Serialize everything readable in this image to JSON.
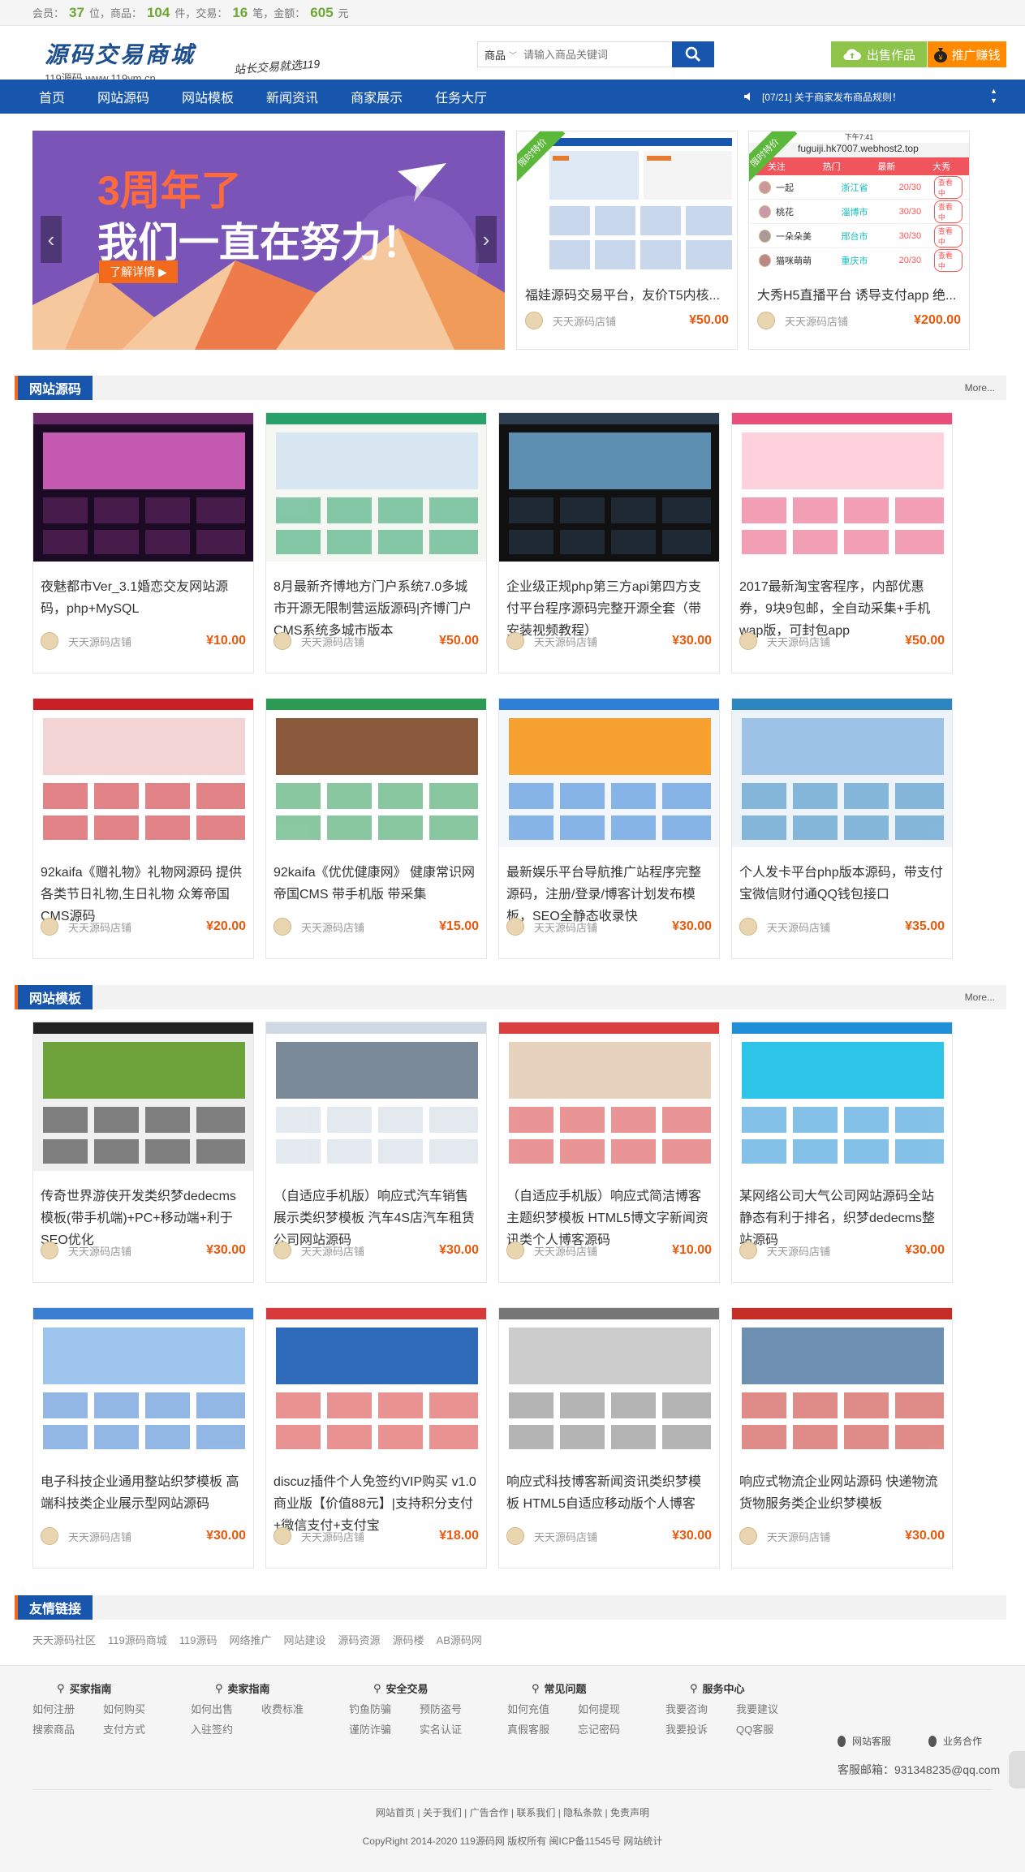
{
  "topbar": {
    "members_label": "会员：",
    "members": "37",
    "members_unit": "位，商品：",
    "goods": "104",
    "goods_unit": "件，交易：",
    "trades": "16",
    "trades_unit": "笔，金额：",
    "amount": "605",
    "amount_unit": "元"
  },
  "logo": {
    "title": "源码交易商城",
    "sub": "119源码   www.119ym.cn",
    "slogan": "站长交易就选119"
  },
  "search": {
    "category": "商品",
    "placeholder": "请输入商品关键词"
  },
  "header_buttons": {
    "sell": "出售作品",
    "promo": "推广赚钱"
  },
  "nav": {
    "items": [
      "首页",
      "网站源码",
      "网站模板",
      "新闻资讯",
      "商家展示",
      "任务大厅"
    ],
    "notice": "[07/21] 关于商家发布商品规则！"
  },
  "banner": {
    "line1": "3周年了",
    "line2": "我们一直在努力！",
    "button": "了解详情 ▶"
  },
  "featured": [
    {
      "ribbon": "限时特价",
      "title": "福娃源码交易平台，友价T5内核...",
      "shop": "天天源码店铺",
      "price": "¥50.00"
    },
    {
      "ribbon": "限时特价",
      "title": "大秀H5直播平台 诱导支付app 绝...",
      "shop": "天天源码店铺",
      "price": "¥200.00",
      "url": "fuguiji.hk7007.webhost2.top",
      "tabs": [
        "关注",
        "热门",
        "最新",
        "大秀"
      ],
      "status": "下午7:41",
      "rows": [
        {
          "name": "一起",
          "loc": "浙江省",
          "age": "20/30",
          "act": "查看中"
        },
        {
          "name": "桃花",
          "loc": "淄博市",
          "age": "30/30",
          "act": "查看中"
        },
        {
          "name": "一朵朵美",
          "loc": "邢台市",
          "age": "30/30",
          "act": "查看中"
        },
        {
          "name": "猫咪萌萌",
          "loc": "重庆市",
          "age": "20/30",
          "act": "查看中"
        }
      ]
    }
  ],
  "sections": [
    {
      "title": "网站源码",
      "more": "More...",
      "items": [
        {
          "title": "夜魅都市Ver_3.1婚恋交友网站源码，php+MySQL",
          "shop": "天天源码店铺",
          "price": "¥10.00"
        },
        {
          "title": "8月最新齐博地方门户系统7.0多城市开源无限制营运版源码|齐博门户CMS系统多城市版本",
          "shop": "天天源码店铺",
          "price": "¥50.00"
        },
        {
          "title": "企业级正规php第三方api第四方支付平台程序源码完整开源全套（带安装视频教程）",
          "shop": "天天源码店铺",
          "price": "¥30.00"
        },
        {
          "title": "2017最新淘宝客程序，内部优惠券，9块9包邮，全自动采集+手机wap版，可封包app",
          "shop": "天天源码店铺",
          "price": "¥50.00"
        },
        {
          "title": "92kaifa《赠礼物》礼物网源码 提供各类节日礼物,生日礼物 众筹帝国CMS源码",
          "shop": "天天源码店铺",
          "price": "¥20.00"
        },
        {
          "title": "92kaifa《优优健康网》 健康常识网帝国CMS 带手机版 带采集",
          "shop": "天天源码店铺",
          "price": "¥15.00"
        },
        {
          "title": "最新娱乐平台导航推广站程序完整源码，注册/登录/博客计划发布模板，SEO全静态收录快",
          "shop": "天天源码店铺",
          "price": "¥30.00"
        },
        {
          "title": "个人发卡平台php版本源码，带支付宝微信财付通QQ钱包接口",
          "shop": "天天源码店铺",
          "price": "¥35.00"
        }
      ]
    },
    {
      "title": "网站模板",
      "more": "More...",
      "items": [
        {
          "title": "传奇世界游侠开发类织梦dedecms模板(带手机端)+PC+移动端+利于SEO优化",
          "shop": "天天源码店铺",
          "price": "¥30.00"
        },
        {
          "title": "（自适应手机版）响应式汽车销售展示类织梦模板 汽车4S店汽车租赁公司网站源码",
          "shop": "天天源码店铺",
          "price": "¥30.00"
        },
        {
          "title": "（自适应手机版）响应式简洁博客主题织梦模板 HTML5博文字新闻资讯类个人博客源码",
          "shop": "天天源码店铺",
          "price": "¥10.00"
        },
        {
          "title": "某网络公司大气公司网站源码全站静态有利于排名，织梦dedecms整站源码",
          "shop": "天天源码店铺",
          "price": "¥30.00"
        },
        {
          "title": "电子科技企业通用整站织梦模板 高端科技类企业展示型网站源码",
          "shop": "天天源码店铺",
          "price": "¥30.00"
        },
        {
          "title": "discuz插件个人免签约VIP购买 v1.0 商业版【价值88元】|支持积分支付+微信支付+支付宝",
          "shop": "天天源码店铺",
          "price": "¥18.00"
        },
        {
          "title": "响应式科技博客新闻资讯类织梦模板 HTML5自适应移动版个人博客",
          "shop": "天天源码店铺",
          "price": "¥30.00"
        },
        {
          "title": "响应式物流企业网站源码 快递物流货物服务类企业织梦模板",
          "shop": "天天源码店铺",
          "price": "¥30.00"
        }
      ]
    }
  ],
  "friend_links": {
    "title": "友情链接",
    "items": [
      "天天源码社区",
      "119源码商城",
      "119源码",
      "网络推广",
      "网站建设",
      "源码资源",
      "源码楼",
      "AB源码网"
    ]
  },
  "footer": {
    "columns": [
      {
        "title": "买家指南",
        "links": [
          "如何注册",
          "如何购买",
          "搜索商品",
          "支付方式"
        ]
      },
      {
        "title": "卖家指南",
        "links": [
          "如何出售",
          "收费标准",
          "入驻签约"
        ]
      },
      {
        "title": "安全交易",
        "links": [
          "钓鱼防骗",
          "预防盗号",
          "谨防诈骗",
          "实名认证"
        ]
      },
      {
        "title": "常见问题",
        "links": [
          "如何充值",
          "如何提现",
          "真假客服",
          "忘记密码"
        ]
      },
      {
        "title": "服务中心",
        "links": [
          "我要咨询",
          "我要建议",
          "我要投诉",
          "QQ客服"
        ]
      }
    ],
    "service": "网站客服",
    "business": "业务合作",
    "email": "客服邮箱：931348235@qq.com",
    "links": "网站首页 | 关于我们 | 广告合作 | 联系我们 | 隐私条款 | 免责声明",
    "copyright": "CopyRight 2014-2020 119源码网 版权所有 闽ICP备11545号 网站统计"
  },
  "colors": {
    "brand_blue": "#1856ad",
    "accent_orange": "#f26a1b",
    "price_orange": "#e8590c",
    "green": "#8dc449"
  }
}
